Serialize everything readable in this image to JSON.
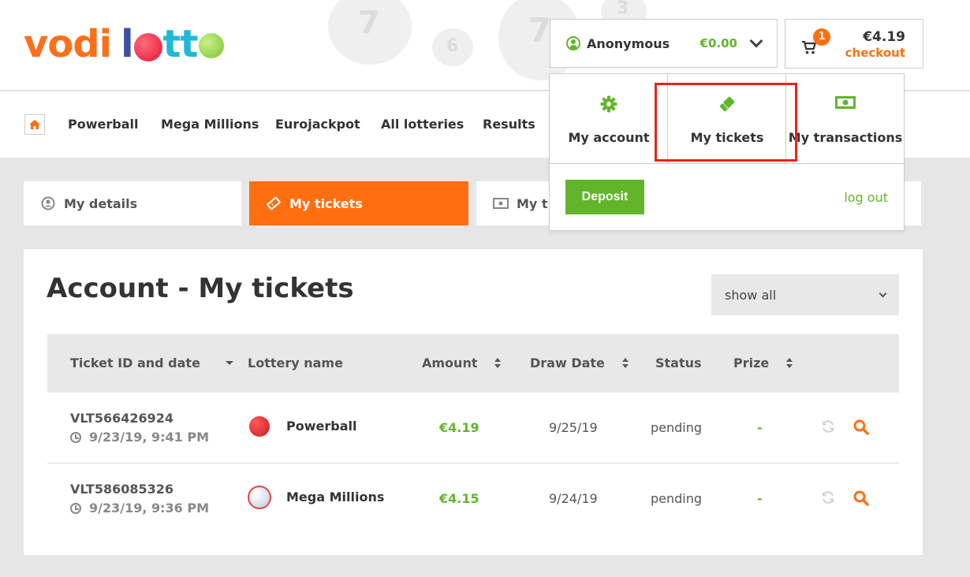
{
  "brand": {
    "logo_v": "vodi",
    "logo_l": "l",
    "logo_t": "tt"
  },
  "header": {
    "user_name": "Anonymous",
    "user_balance": "€0.00",
    "cart_count": "1",
    "cart_total": "€4.19",
    "cart_checkout": "checkout"
  },
  "nav": {
    "items": [
      "Powerball",
      "Mega Millions",
      "Eurojackpot",
      "All lotteries",
      "Results"
    ]
  },
  "dropdown": {
    "tiles": [
      {
        "label": "My account",
        "icon": "gear-icon"
      },
      {
        "label": "My tickets",
        "icon": "ticket-icon"
      },
      {
        "label": "My transactions",
        "icon": "money-icon"
      }
    ],
    "deposit_label": "Deposit",
    "logout_label": "log out"
  },
  "tabs": [
    {
      "label": "My details",
      "icon": "user-circle-icon"
    },
    {
      "label": "My tickets",
      "icon": "ticket-icon",
      "active": true
    },
    {
      "label": "My tr",
      "icon": "money-icon"
    }
  ],
  "main": {
    "title": "Account - My tickets",
    "filter_value": "show all",
    "columns": [
      "Ticket ID and date",
      "Lottery name",
      "Amount",
      "Draw Date",
      "Status",
      "Prize"
    ],
    "rows": [
      {
        "ticket_id": "VLT566426924",
        "date": "9/23/19, 9:41 PM",
        "lottery": "Powerball",
        "amount": "€4.19",
        "draw_date": "9/25/19",
        "status": "pending",
        "prize": "-"
      },
      {
        "ticket_id": "VLT586085326",
        "date": "9/23/19, 9:36 PM",
        "lottery": "Mega Millions",
        "amount": "€4.15",
        "draw_date": "9/24/19",
        "status": "pending",
        "prize": "-"
      }
    ]
  },
  "colors": {
    "accent_orange": "#ff6f0f",
    "accent_green": "#62b52b",
    "highlight_red": "#e8241a"
  }
}
